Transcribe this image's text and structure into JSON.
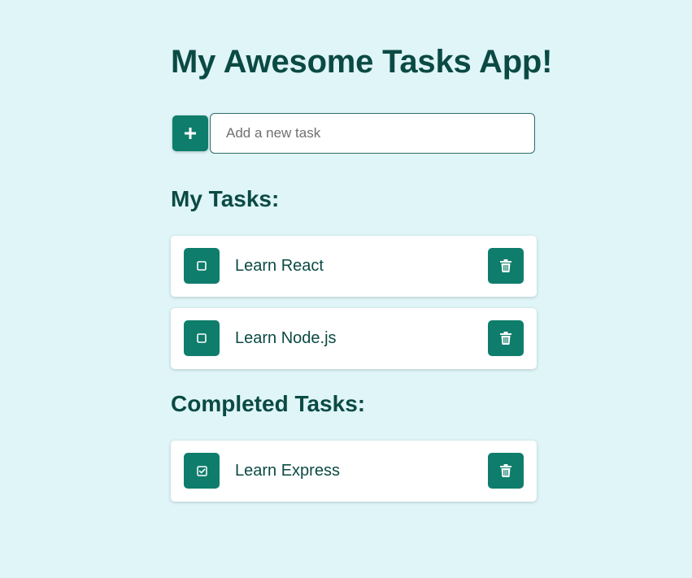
{
  "app": {
    "title": "My Awesome Tasks App!"
  },
  "add_task": {
    "button_icon": "plus-icon",
    "placeholder": "Add a new task",
    "value": ""
  },
  "sections": {
    "my_tasks_title": "My Tasks:",
    "completed_title": "Completed Tasks:"
  },
  "my_tasks": [
    {
      "label": "Learn React",
      "completed": false,
      "check_icon": "checkbox-empty-icon",
      "delete_icon": "trash-icon"
    },
    {
      "label": "Learn Node.js",
      "completed": false,
      "check_icon": "checkbox-empty-icon",
      "delete_icon": "trash-icon"
    }
  ],
  "completed_tasks": [
    {
      "label": "Learn Express",
      "completed": true,
      "check_icon": "checkbox-checked-icon",
      "delete_icon": "trash-icon"
    }
  ],
  "colors": {
    "background": "#dff5f8",
    "accent": "#0f7d6c",
    "text": "#0b4a44",
    "card": "#ffffff"
  }
}
